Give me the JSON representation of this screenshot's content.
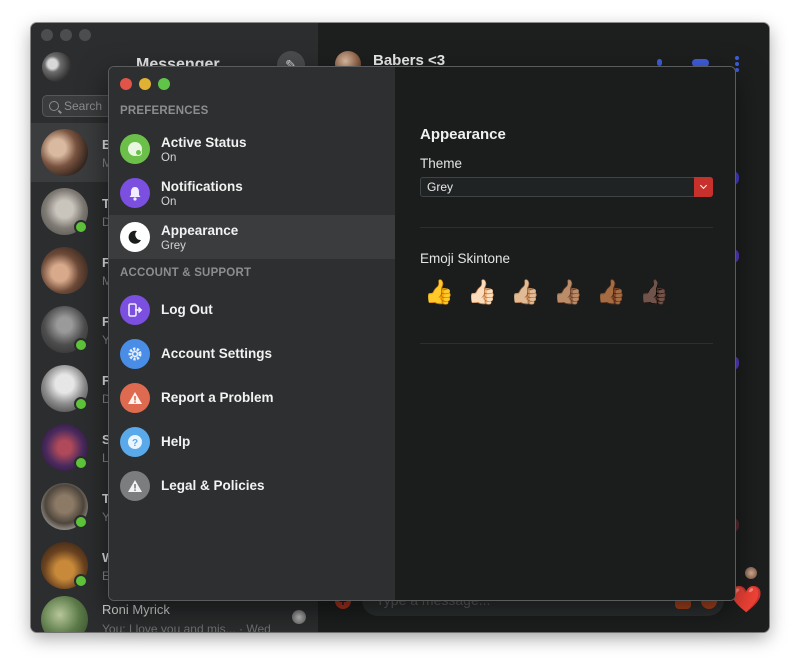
{
  "main_window": {
    "app_title": "Messenger",
    "search_placeholder": "Search",
    "conversations": [
      {
        "initial": "E",
        "snippet_initial": "M",
        "online": false,
        "active": true
      },
      {
        "initial": "T",
        "snippet_initial": "D",
        "online": true,
        "active": false
      },
      {
        "initial": "F",
        "snippet_initial": "M",
        "online": false,
        "active": false
      },
      {
        "initial": "F",
        "snippet_initial": "Y",
        "online": true,
        "active": false
      },
      {
        "initial": "F",
        "snippet_initial": "D",
        "online": true,
        "active": false
      },
      {
        "initial": "S",
        "snippet_initial": "L",
        "online": true,
        "active": false
      },
      {
        "initial": "T",
        "snippet_initial": "Y",
        "online": true,
        "active": false
      },
      {
        "initial": "W",
        "snippet_initial": "E",
        "online": true,
        "active": false
      }
    ],
    "last_conversation": {
      "name": "Roni Myrick",
      "snippet": "You: I love you and mis...",
      "time": "Wed"
    },
    "chat": {
      "title": "Babers <3",
      "message_placeholder": "Type a message...",
      "heart_icon": "❤️"
    }
  },
  "preferences": {
    "section_preferences": "PREFERENCES",
    "section_account": "ACCOUNT & SUPPORT",
    "pref_items": [
      {
        "label": "Active Status",
        "value": "On",
        "icon": "active-status-icon",
        "color": "#6cc04a"
      },
      {
        "label": "Notifications",
        "value": "On",
        "icon": "bell-icon",
        "color": "#7b4fe0"
      },
      {
        "label": "Appearance",
        "value": "Grey",
        "icon": "moon-icon",
        "color": "#ffffff",
        "selected": true
      }
    ],
    "account_items": [
      {
        "label": "Log Out",
        "icon": "logout-icon",
        "color": "#7b4fe0"
      },
      {
        "label": "Account Settings",
        "icon": "gear-icon",
        "color": "#4a8de6"
      },
      {
        "label": "Report a Problem",
        "icon": "warning-icon",
        "color": "#de6a4f"
      },
      {
        "label": "Help",
        "icon": "help-icon",
        "color": "#5aa9ea"
      },
      {
        "label": "Legal & Policies",
        "icon": "warning-icon",
        "color": "#7b7d7f"
      }
    ],
    "content": {
      "title": "Appearance",
      "theme_label": "Theme",
      "theme_value": "Grey",
      "emoji_label": "Emoji Skintone",
      "skintones": [
        "👍",
        "👍🏻",
        "👍🏼",
        "👍🏽",
        "👍🏾",
        "👍🏿"
      ]
    }
  },
  "colors": {
    "accent_blue": "#3f5ee0",
    "select_arrow_red": "#c7312c",
    "online_green": "#5fc53a"
  }
}
